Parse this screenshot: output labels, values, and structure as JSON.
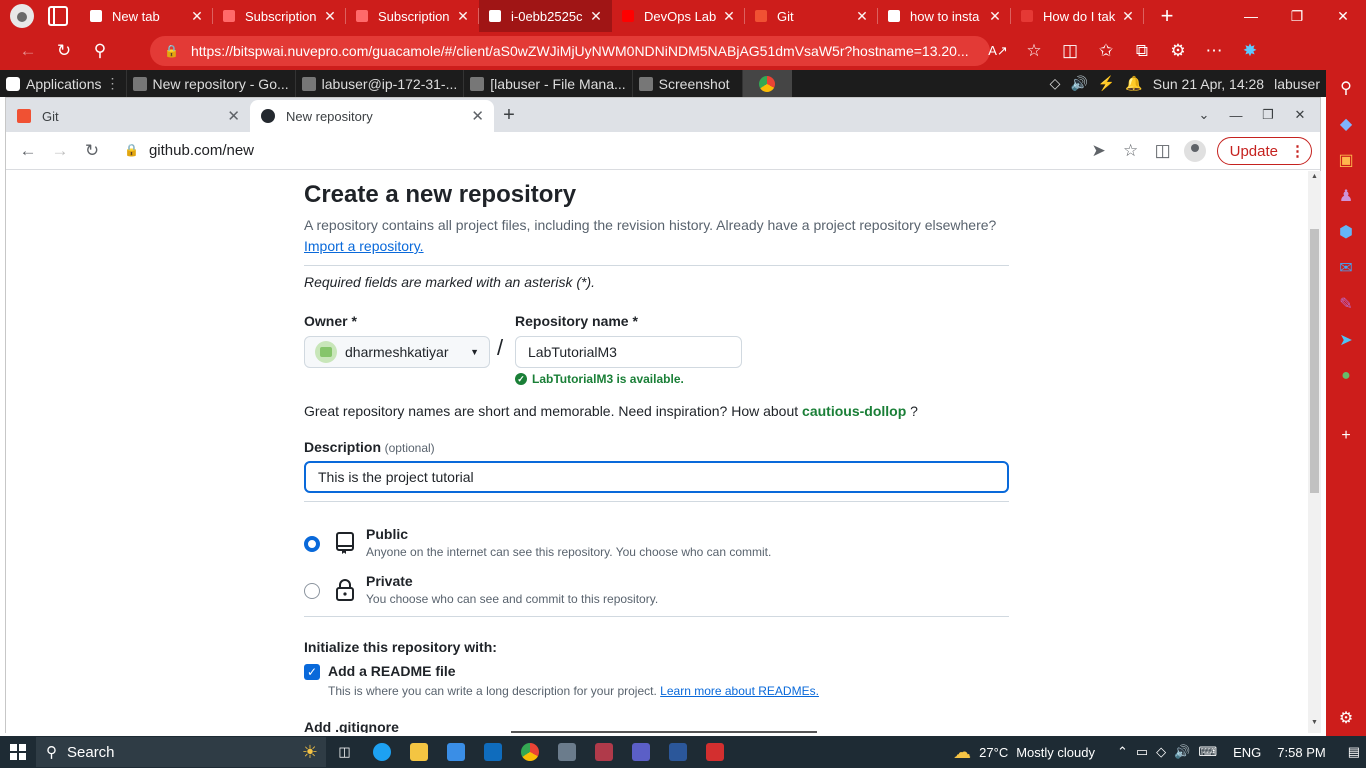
{
  "edge": {
    "tabs": [
      {
        "title": "New tab",
        "icon": "edge-page-icon",
        "color": "#ffffff"
      },
      {
        "title": "Subscription",
        "icon": "redhat-icon",
        "color": "#ff6a6a"
      },
      {
        "title": "Subscription",
        "icon": "redhat-icon",
        "color": "#ff6a6a"
      },
      {
        "title": "i-0ebb2525c",
        "icon": "guacamole-icon",
        "color": "#ffffff",
        "active": true
      },
      {
        "title": "DevOps Lab",
        "icon": "youtube-icon",
        "color": "#ff0000"
      },
      {
        "title": "Git",
        "icon": "git-icon",
        "color": "#f05133"
      },
      {
        "title": "how to insta",
        "icon": "google-icon",
        "color": "#ffffff"
      },
      {
        "title": "How do I tak",
        "icon": "ask-icon",
        "color": "#e53935"
      }
    ],
    "url": "https://bitspwai.nuvepro.com/guacamole/#/client/aS0wZWJiMjUyNWM0NDNiNDM5NABjAG51dmVsaW5r?hostname=13.20..."
  },
  "xfce": {
    "applications_label": "Applications",
    "tasks": [
      {
        "title": "New repository - Go...",
        "icon": "chrome-icon"
      },
      {
        "title": "labuser@ip-172-31-...",
        "icon": "terminal-icon"
      },
      {
        "title": "[labuser - File Mana...",
        "icon": "home-folder-icon"
      },
      {
        "title": "Screenshot",
        "icon": "camera-icon"
      }
    ],
    "datetime": "Sun 21 Apr, 14:28",
    "user": "labuser"
  },
  "chrome": {
    "tabs": [
      {
        "title": "Git",
        "icon": "git-icon"
      },
      {
        "title": "New repository",
        "icon": "github-icon",
        "active": true
      }
    ],
    "url": "github.com/new",
    "update_label": "Update"
  },
  "page": {
    "title": "Create a new repository",
    "subtitle": "A repository contains all project files, including the revision history. Already have a project repository elsewhere?",
    "import_link": "Import a repository.",
    "required_note": "Required fields are marked with an asterisk (*).",
    "owner_label": "Owner *",
    "owner_value": "dharmeshkatiyar",
    "repo_label": "Repository name *",
    "repo_value": "LabTutorialM3",
    "availability": "LabTutorialM3 is available.",
    "inspiration_text": "Great repository names are short and memorable. Need inspiration? How about",
    "suggestion": "cautious-dollop",
    "inspiration_end": "?",
    "description_label": "Description",
    "description_optional": "(optional)",
    "description_value": "This is the project tutorial",
    "visibility": [
      {
        "title": "Public",
        "desc": "Anyone on the internet can see this repository. You choose who can commit.",
        "selected": true
      },
      {
        "title": "Private",
        "desc": "You choose who can see and commit to this repository.",
        "selected": false
      }
    ],
    "init_label": "Initialize this repository with:",
    "readme_label": "Add a README file",
    "readme_desc": "This is where you can write a long description for your project.",
    "readme_link": "Learn more about READMEs.",
    "gitignore_label": "Add .gitignore"
  },
  "taskbar": {
    "search_label": "Search",
    "weather": "27°C",
    "weather_desc": "Mostly cloudy",
    "language": "ENG",
    "time": "7:58 PM"
  }
}
